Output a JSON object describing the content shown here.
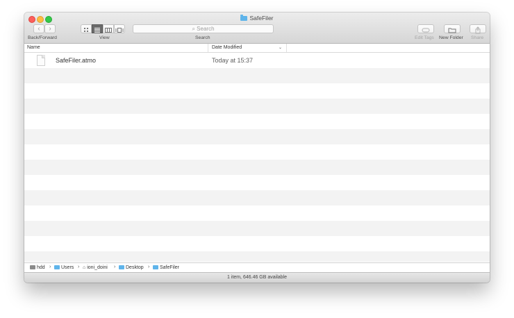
{
  "window": {
    "title": "SafeFiler"
  },
  "toolbar": {
    "back_icon": "‹",
    "forward_icon": "›",
    "back_forward_label": "Back/Forward",
    "view_label": "View",
    "search_placeholder": "Search",
    "search_label": "Search",
    "search_icon": "⌕",
    "edit_tags_label": "Edit Tags",
    "new_folder_label": "New Folder",
    "share_label": "Share"
  },
  "columns": {
    "name": "Name",
    "date_modified": "Date Modified",
    "sort_icon": "⌄"
  },
  "files": [
    {
      "name": "SafeFiler.atmo",
      "date": "Today at 15:37"
    }
  ],
  "path": {
    "items": [
      "hdd",
      "Users",
      "ioni_doini",
      "Desktop",
      "SafeFiler"
    ],
    "sep": "›"
  },
  "status": {
    "text": "1 item, 646.46 GB available"
  },
  "colors": {
    "folder": "#5fb4ea",
    "close": "#fc605c",
    "minimize": "#fdbc40",
    "maximize": "#34c84a"
  }
}
